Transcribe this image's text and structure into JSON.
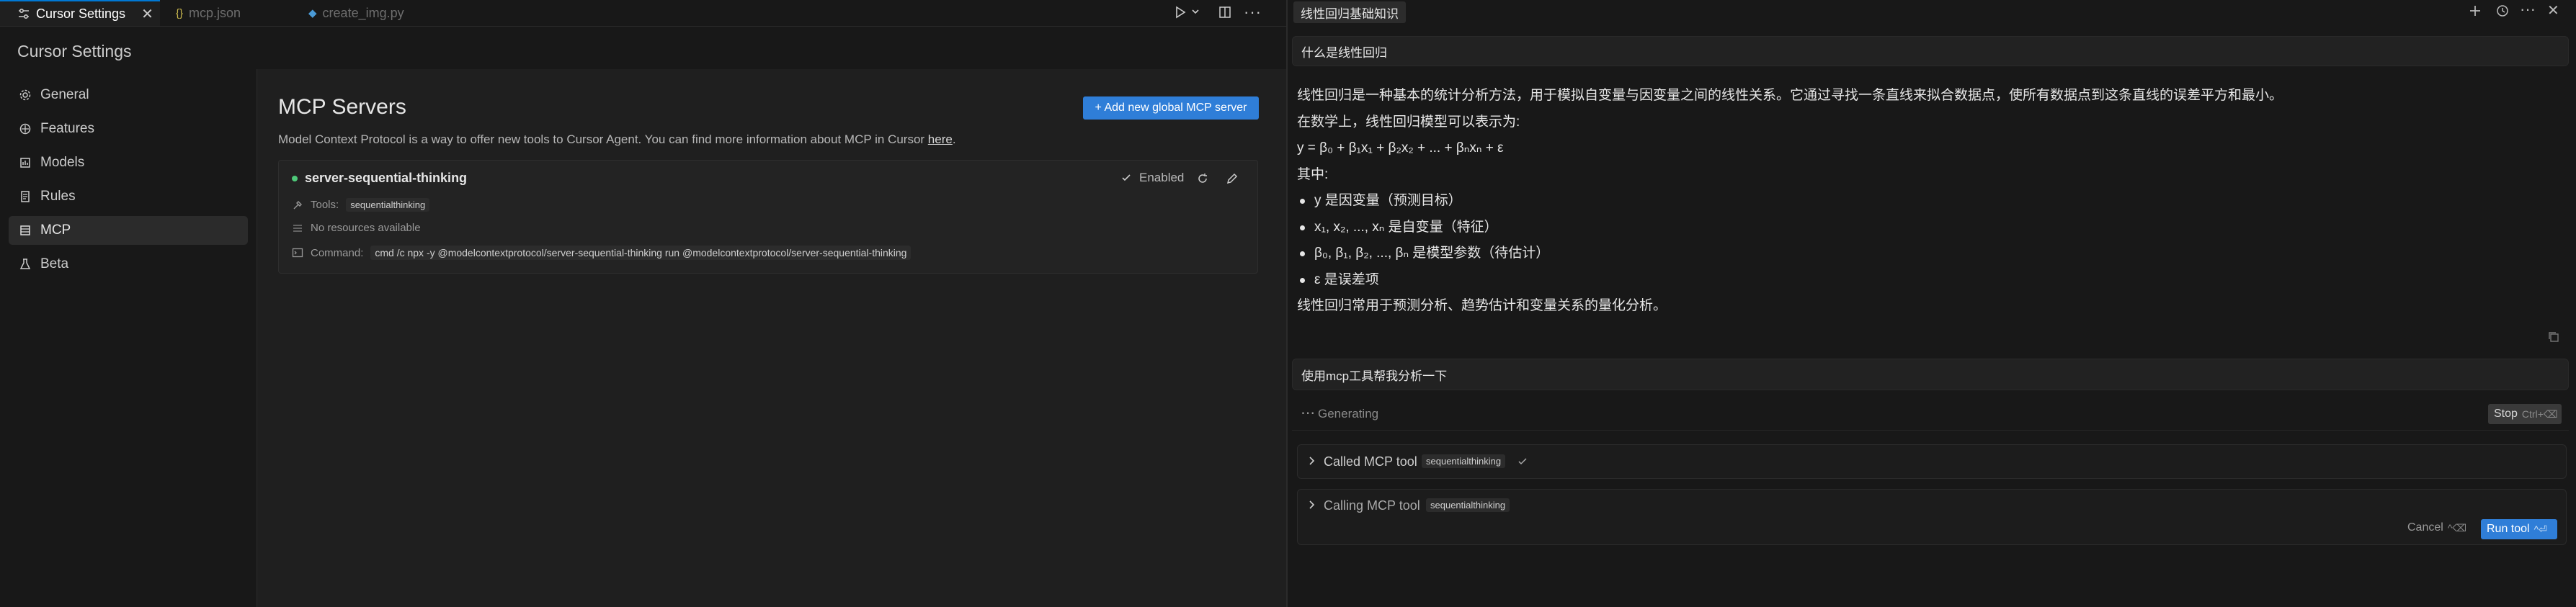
{
  "tabs": [
    {
      "label": "Cursor Settings",
      "icon": "settings-sliders-icon",
      "active": true
    },
    {
      "label": "mcp.json",
      "icon": "json-braces-icon",
      "active": false
    },
    {
      "label": "create_img.py",
      "icon": "python-file-icon",
      "active": false
    }
  ],
  "settings": {
    "title": "Cursor Settings",
    "nav": [
      {
        "label": "General",
        "icon": "gear-icon"
      },
      {
        "label": "Features",
        "icon": "features-icon"
      },
      {
        "label": "Models",
        "icon": "models-icon"
      },
      {
        "label": "Rules",
        "icon": "rules-icon"
      },
      {
        "label": "MCP",
        "icon": "mcp-icon",
        "selected": true
      },
      {
        "label": "Beta",
        "icon": "flask-icon"
      }
    ]
  },
  "mcp": {
    "title": "MCP Servers",
    "add_button": "+ Add new global MCP server",
    "description": "Model Context Protocol is a way to offer new tools to Cursor Agent. You can find more information about MCP in Cursor ",
    "description_link": "here",
    "description_end": ".",
    "server": {
      "name": "server-sequential-thinking",
      "status_color": "#4ec979",
      "enabled_label": "Enabled",
      "tools_label": "Tools:",
      "tool_chip": "sequentialthinking",
      "resources_text": "No resources available",
      "command_label": "Command:",
      "command_value": "cmd /c npx -y @modelcontextprotocol/server-sequential-thinking run @modelcontextprotocol/server-sequential-thinking"
    }
  },
  "chat": {
    "tab_title": "线性回归基础知识",
    "question": "什么是线性回归",
    "answer": {
      "p1": "线性回归是一种基本的统计分析方法，用于模拟自变量与因变量之间的线性关系。它通过寻找一条直线来拟合数据点，使所有数据点到这条直线的误差平方和最小。",
      "p2": "在数学上，线性回归模型可以表示为:",
      "formula": "y = β₀ + β₁x₁ + β₂x₂ + ... + βₙxₙ + ε",
      "p3": "其中:",
      "bullets": [
        "y 是因变量（预测目标）",
        "x₁, x₂, ..., xₙ 是自变量（特征）",
        "β₀, β₁, β₂, ..., βₙ 是模型参数（待估计）",
        "ε 是误差项"
      ],
      "p4": "线性回归常用于预测分析、趋势估计和变量关系的量化分析。"
    },
    "followup": "使用mcp工具帮我分析一下",
    "generating": "Generating",
    "stop_label": "Stop",
    "stop_kbd": "Ctrl+⌫",
    "called_label": "Called MCP tool",
    "called_chip": "sequentialthinking",
    "calling_label": "Calling MCP tool",
    "calling_chip": "sequentialthinking",
    "cancel_label": "Cancel",
    "cancel_kbd": "^⌫",
    "run_label": "Run tool",
    "run_kbd": "^⏎"
  },
  "colors": {
    "accent": "#2f7ed8",
    "enabled_dot": "#4ec979"
  }
}
